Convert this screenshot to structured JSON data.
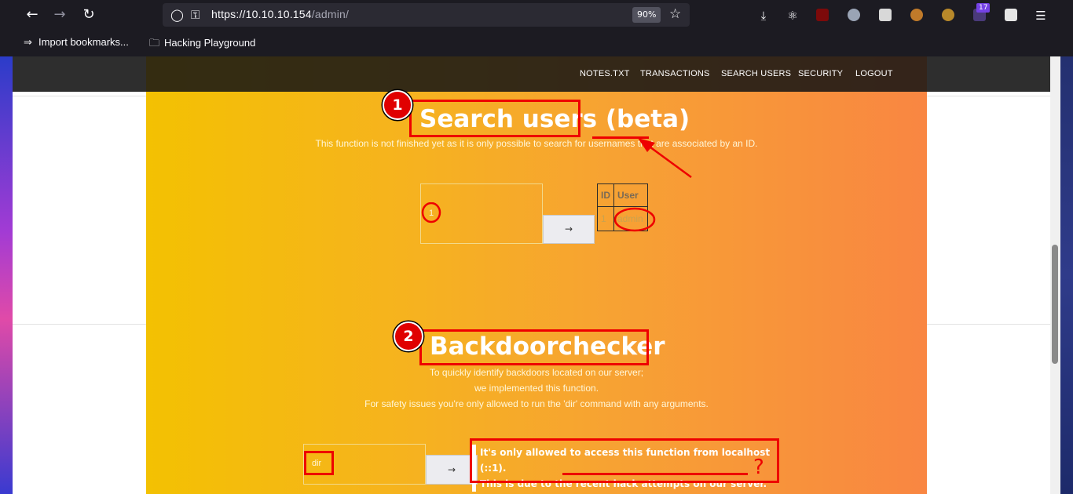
{
  "browser": {
    "url_host": "https://10.10.10.154",
    "url_path": "/admin/",
    "zoom": "90%",
    "extension_badge": "17",
    "bookmarks": [
      {
        "label": "Import bookmarks..."
      },
      {
        "label": "Hacking Playground"
      }
    ]
  },
  "nav": {
    "items": [
      {
        "label": "NOTES.TXT"
      },
      {
        "label": "TRANSACTIONS"
      },
      {
        "label": "SEARCH USERS"
      },
      {
        "label": "SECURITY"
      },
      {
        "label": "LOGOUT"
      }
    ]
  },
  "search": {
    "title_main": "Search users",
    "title_beta": "(beta)",
    "subtitle": "This function is not finished yet as it is only possible to search for usernames that are associated by an ID.",
    "input_value": "1",
    "button_label": "→",
    "table": {
      "headers": [
        "ID",
        "User"
      ],
      "rows": [
        [
          "1",
          "admin"
        ]
      ]
    }
  },
  "backdoor": {
    "title": "Backdoorchecker",
    "lines": [
      "To quickly identify backdoors located on our server;",
      "we implemented this function.",
      "For safety issues you're only allowed to run the 'dir' command with any arguments."
    ],
    "input_value": "dir",
    "button_label": "→",
    "error_line1": "It's only allowed to access this function from localhost (::1).",
    "error_line2": "This is due to the recent hack attempts on our server."
  },
  "annotations": {
    "marker1": "1",
    "marker2": "2",
    "question": "?"
  },
  "colors": {
    "annotation_red": "#ee0000",
    "gradient_start": "#f3c102",
    "gradient_end": "#f98642",
    "nav_bg": "#2e2e2e"
  }
}
